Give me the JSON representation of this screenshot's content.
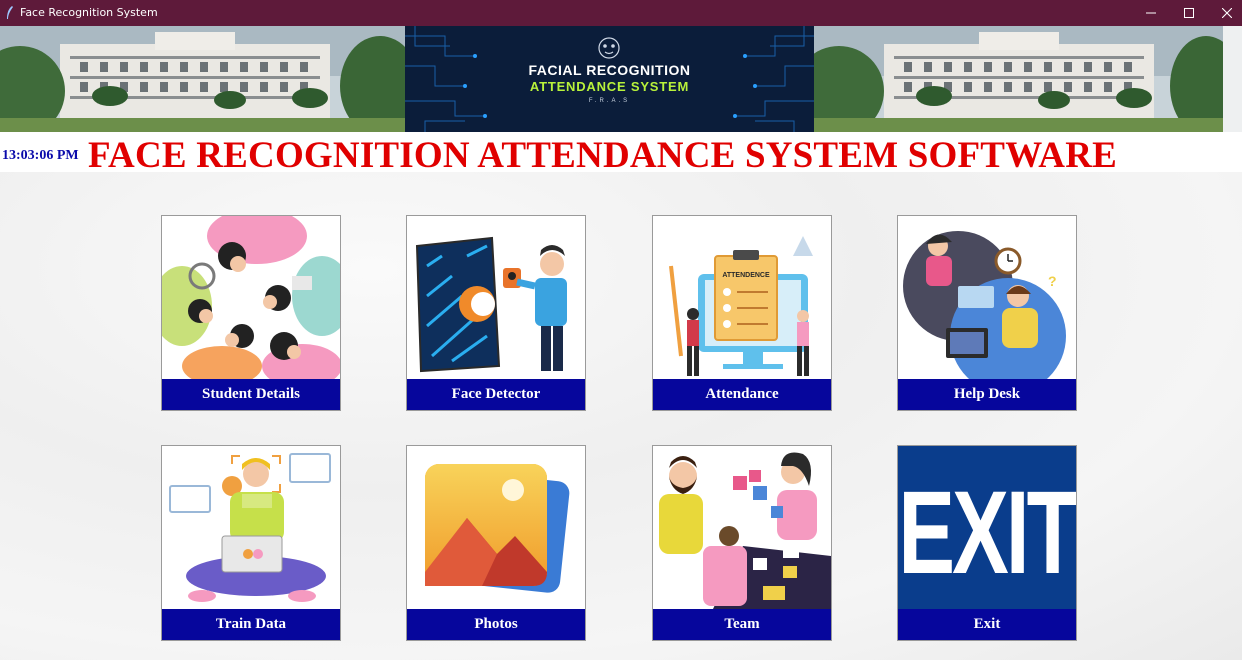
{
  "window": {
    "title": "Face Recognition System",
    "controls": [
      "minimize-icon",
      "maximize-icon",
      "close-icon"
    ]
  },
  "banner": {
    "logo_line1": "FACIAL RECOGNITION",
    "logo_line2": "ATTENDANCE SYSTEM",
    "logo_abbrev": "F.R.A.S"
  },
  "header": {
    "clock": "13:03:06 PM",
    "title": "FACE RECOGNITION ATTENDANCE SYSTEM SOFTWARE"
  },
  "tiles": [
    {
      "label": "Student Details",
      "icon": "students-icon"
    },
    {
      "label": "Face Detector",
      "icon": "face-scan-icon"
    },
    {
      "label": "Attendance",
      "icon": "attendance-clipboard-icon"
    },
    {
      "label": "Help Desk",
      "icon": "help-desk-icon"
    },
    {
      "label": "Train Data",
      "icon": "train-data-icon"
    },
    {
      "label": "Photos",
      "icon": "photos-icon"
    },
    {
      "label": "Team",
      "icon": "team-puzzle-icon"
    },
    {
      "label": "Exit",
      "icon": "exit-sign-icon",
      "image_text": "EXIT"
    }
  ],
  "colors": {
    "titlebar": "#5e1a3a",
    "label_bar": "#06069c",
    "title_red": "#e00000",
    "clock_blue": "#0a0aaa",
    "exit_bg": "#0a3d8c"
  }
}
